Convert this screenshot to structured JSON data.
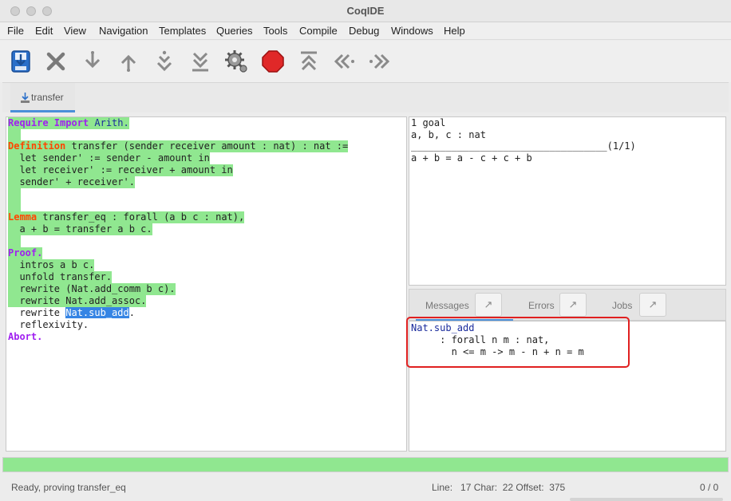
{
  "window": {
    "title": "CoqIDE"
  },
  "menu": [
    "File",
    "Edit",
    "View",
    "Navigation",
    "Templates",
    "Queries",
    "Tools",
    "Compile",
    "Debug",
    "Windows",
    "Help"
  ],
  "toolbar": [
    {
      "name": "save-icon"
    },
    {
      "name": "close-icon"
    },
    {
      "name": "forward-one-icon"
    },
    {
      "name": "backward-one-icon"
    },
    {
      "name": "go-to-cursor-icon"
    },
    {
      "name": "forward-to-end-icon"
    },
    {
      "name": "settings-gear-icon"
    },
    {
      "name": "interrupt-stop-icon"
    },
    {
      "name": "backward-to-start-icon"
    },
    {
      "name": "previous-occurrence-icon"
    },
    {
      "name": "next-occurrence-icon"
    }
  ],
  "tab": {
    "label": "transfer"
  },
  "editor": {
    "lines": [
      {
        "k": "Require Import",
        "r": " Arith.",
        "kc": "purple",
        "hl": true
      },
      {
        "k": "Definition",
        "r": " transfer (sender receiver amount : nat) : nat :=",
        "kc": "orange",
        "hl": true
      },
      {
        "k": "",
        "r": "  let sender' := sender - amount in",
        "kc": "",
        "hl": true
      },
      {
        "k": "",
        "r": "  let receiver' := receiver + amount in",
        "kc": "",
        "hl": true
      },
      {
        "k": "",
        "r": "  sender' + receiver'.",
        "kc": "",
        "hl": true
      },
      {
        "k": "Lemma",
        "r": " transfer_eq : forall (a b c : nat),",
        "kc": "orange",
        "hl": true
      },
      {
        "k": "",
        "r": "  a + b = transfer a b c.",
        "kc": "",
        "hl": true
      },
      {
        "k": "Proof.",
        "r": "",
        "kc": "purple",
        "hl": true
      },
      {
        "k": "",
        "r": "  intros a b c.",
        "kc": "",
        "hl": true
      },
      {
        "k": "",
        "r": "  unfold transfer.",
        "kc": "",
        "hl": true
      },
      {
        "k": "",
        "r": "  rewrite (Nat.add_comm b c).",
        "kc": "",
        "hl": true
      },
      {
        "k": "",
        "r": "  rewrite Nat.add_assoc.",
        "kc": "",
        "hl": true
      },
      {
        "k": "",
        "r": "  rewrite ",
        "kc": "",
        "hl": false,
        "sel": "Nat.sub_add",
        "after": "."
      },
      {
        "k": "",
        "r": "  reflexivity.",
        "kc": "",
        "hl": false
      },
      {
        "k": "Abort.",
        "r": "",
        "kc": "purple",
        "hl": false
      }
    ]
  },
  "goals": {
    "count": "1 goal",
    "hyp": "a, b, c : nat",
    "sep": "__________________________________(1/1)",
    "goal": "a + b = a - c + c + b"
  },
  "msg_tabs": {
    "messages": "Messages",
    "errors": "Errors",
    "jobs": "Jobs",
    "detach": "↗"
  },
  "messages": {
    "name": "Nat.sub_add",
    "type_line1": "     : forall n m : nat,",
    "type_line2": "       n <= m -> m - n + n = m"
  },
  "status": {
    "left": "Ready, proving transfer_eq",
    "position": "Line:   17 Char:  22 Offset:  375",
    "count": "0 / 0"
  }
}
